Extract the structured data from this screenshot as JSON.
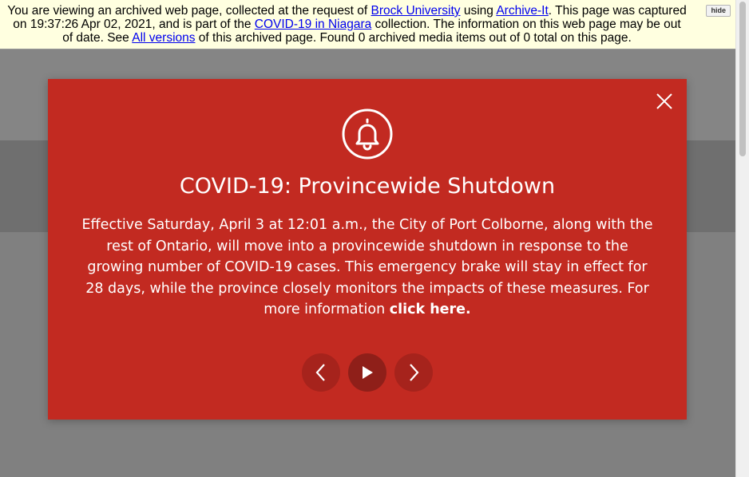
{
  "banner": {
    "t1": "You are viewing an archived web page, collected at the request of ",
    "link_org": "Brock University",
    "t2": " using ",
    "link_archive": "Archive-It",
    "t3": ". This page was captured on 19:37:26 Apr 02, 2021, and is part of the ",
    "link_collection": "COVID-19 in Niagara",
    "t4": " collection. The information on this web page may be out of date. See ",
    "link_versions": "All versions",
    "t5": " of this archived page. Found 0 archived media items out of 0 total on this page.",
    "hide_label": "hide"
  },
  "modal": {
    "title": "COVID-19: Provincewide Shutdown",
    "body": "Effective Saturday, April 3 at 12:01 a.m., the City of Port Colborne, along with the rest of Ontario, will move into a provincewide shutdown in response to the growing number of COVID-19 cases. This emergency brake will stay in effect for 28 days, while the province closely monitors the impacts of these measures. For more information ",
    "link_text": "click here."
  },
  "icons": {
    "close": "close-icon",
    "bell": "bell-icon",
    "prev": "chevron-left-icon",
    "play": "play-icon",
    "next": "chevron-right-icon"
  },
  "colors": {
    "modal_background": "#c22a21",
    "control_background": "#a6231c",
    "banner_background": "#ffffe0",
    "link": "#0000ee"
  }
}
